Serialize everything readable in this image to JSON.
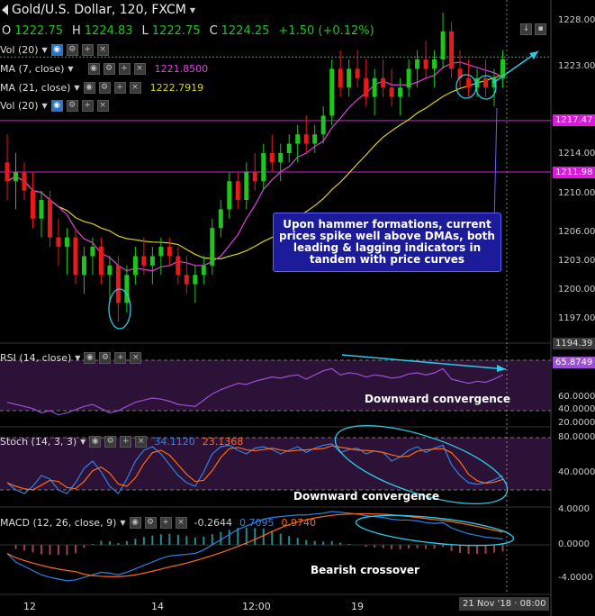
{
  "header": {
    "symbol_title": "Gold/U.S. Dollar, 120, FXCM",
    "ohlc": {
      "o_label": "O",
      "o": "1222.75",
      "h_label": "H",
      "h": "1224.83",
      "l_label": "L",
      "l": "1222.75",
      "c_label": "C",
      "c": "1224.25",
      "change": "+1.50 (+0.12%)"
    }
  },
  "colors": {
    "up": "#1ec51e",
    "down": "#e51a1a",
    "ma7": "#e040e0",
    "ma21": "#d6d41a",
    "level": "#d81bd8",
    "cyan": "#2fc9e6",
    "annotation_bg": "#1c1c9a",
    "rsi": "#9c4fd6",
    "stoch_k": "#2f82e6",
    "stoch_d": "#ff6a1a"
  },
  "indicators": {
    "vol_top": "Vol (20)",
    "ma7_label": "MA (7, close)",
    "ma7_value": "1221.8500",
    "ma21_label": "MA (21, close)",
    "ma21_value": "1222.7919",
    "vol_bottom": "Vol (20)"
  },
  "price_axis": {
    "ticks": [
      "1228.00",
      "1223.00",
      "1214.00",
      "1210.00",
      "1206.00",
      "1203.00",
      "1200.00",
      "1197.00"
    ],
    "level_tags": [
      "1217.47",
      "1211.98"
    ],
    "bottom_tag": "1194.39"
  },
  "annotation_main": "Upon hammer formations, current prices spike well above DMAs, both leading & lagging indicators in tandem with price curves",
  "rsi": {
    "label": "RSI (14, close)",
    "value_tag": "65.8749",
    "ticks": [
      "60.0000",
      "40.0000",
      "20.0000"
    ],
    "caption": "Downward convergence"
  },
  "stoch": {
    "label": "Stoch (14, 3, 3)",
    "k": "34.1120",
    "d": "23.1368",
    "ticks": [
      "80.0000",
      "40.0000"
    ],
    "caption": "Downward convergence"
  },
  "macd": {
    "label": "MACD (12, 26, close, 9)",
    "hist": "-0.2644",
    "macd": "0.7095",
    "signal": "0.9740",
    "ticks": [
      "4.0000",
      "0.0000",
      "-4.0000"
    ],
    "caption": "Bearish crossover"
  },
  "time_axis": {
    "labels": [
      "12",
      "14",
      "12:00",
      "19"
    ],
    "cursor": "21 Nov '18 · 08:00"
  },
  "chart_data": {
    "type": "candlestick",
    "candles": [
      [
        1213,
        1216,
        1209,
        1211
      ],
      [
        1211,
        1214,
        1208,
        1212
      ],
      [
        1212,
        1213,
        1209,
        1210
      ],
      [
        1210,
        1212,
        1206,
        1207
      ],
      [
        1207,
        1210,
        1205,
        1209
      ],
      [
        1209,
        1210,
        1204,
        1205
      ],
      [
        1205,
        1207,
        1202,
        1204
      ],
      [
        1204,
        1206,
        1201,
        1205
      ],
      [
        1205,
        1206,
        1200,
        1201
      ],
      [
        1201,
        1204,
        1199,
        1203
      ],
      [
        1203,
        1205,
        1201,
        1204
      ],
      [
        1204,
        1205,
        1200,
        1201
      ],
      [
        1201,
        1203,
        1198,
        1202
      ],
      [
        1202,
        1203,
        1196,
        1198
      ],
      [
        1198,
        1202,
        1197,
        1201
      ],
      [
        1201,
        1204,
        1200,
        1203
      ],
      [
        1203,
        1205,
        1201,
        1202
      ],
      [
        1202,
        1204,
        1200,
        1203
      ],
      [
        1203,
        1205,
        1201,
        1204
      ],
      [
        1204,
        1205,
        1202,
        1203
      ],
      [
        1203,
        1204,
        1200,
        1201
      ],
      [
        1201,
        1203,
        1199,
        1200
      ],
      [
        1200,
        1202,
        1198,
        1201
      ],
      [
        1201,
        1203,
        1200,
        1202
      ],
      [
        1202,
        1207,
        1201,
        1206
      ],
      [
        1206,
        1209,
        1205,
        1208
      ],
      [
        1208,
        1212,
        1207,
        1211
      ],
      [
        1211,
        1212,
        1208,
        1209
      ],
      [
        1209,
        1213,
        1208,
        1212
      ],
      [
        1212,
        1214,
        1210,
        1211
      ],
      [
        1211,
        1215,
        1210,
        1214
      ],
      [
        1214,
        1216,
        1212,
        1213
      ],
      [
        1213,
        1215,
        1211,
        1214
      ],
      [
        1214,
        1216,
        1213,
        1215
      ],
      [
        1215,
        1217,
        1213,
        1216
      ],
      [
        1216,
        1218,
        1214,
        1215
      ],
      [
        1215,
        1217,
        1214,
        1216
      ],
      [
        1216,
        1219,
        1215,
        1218
      ],
      [
        1218,
        1224,
        1217,
        1223
      ],
      [
        1223,
        1225,
        1220,
        1221
      ],
      [
        1221,
        1224,
        1220,
        1223
      ],
      [
        1223,
        1225,
        1221,
        1222
      ],
      [
        1222,
        1224,
        1219,
        1220
      ],
      [
        1220,
        1223,
        1218,
        1222
      ],
      [
        1222,
        1224,
        1220,
        1221
      ],
      [
        1221,
        1223,
        1219,
        1220
      ],
      [
        1220,
        1222,
        1218,
        1221
      ],
      [
        1221,
        1224,
        1220,
        1223
      ],
      [
        1223,
        1225,
        1221,
        1224
      ],
      [
        1224,
        1226,
        1222,
        1223
      ],
      [
        1223,
        1225,
        1221,
        1224
      ],
      [
        1224,
        1229,
        1223,
        1227
      ],
      [
        1227,
        1228,
        1222,
        1223
      ],
      [
        1223,
        1225,
        1221,
        1222
      ],
      [
        1222,
        1224,
        1220,
        1221
      ],
      [
        1221,
        1223,
        1220,
        1222
      ],
      [
        1222,
        1224,
        1220,
        1221
      ],
      [
        1221,
        1223,
        1219,
        1222
      ],
      [
        1222,
        1225,
        1221,
        1224
      ]
    ],
    "ylim": [
      1194,
      1229
    ]
  }
}
